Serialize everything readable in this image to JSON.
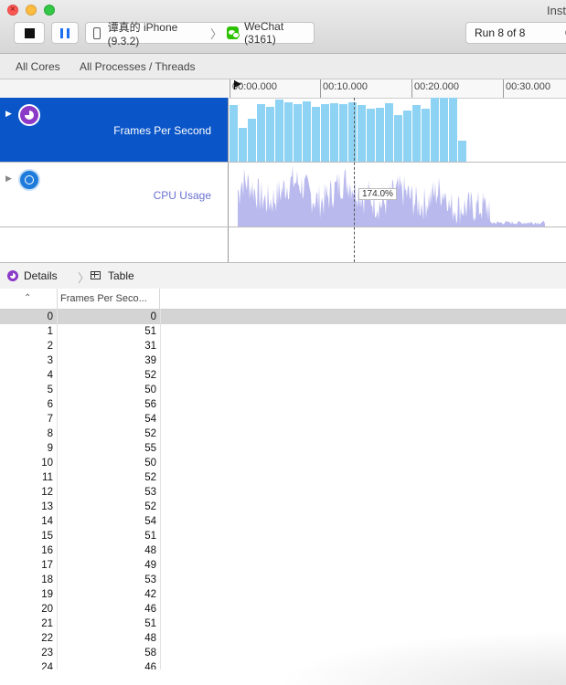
{
  "window": {
    "title": "Inst"
  },
  "toolbar": {
    "device": "谭真的 iPhone (9.3.2)",
    "process": "WeChat (3161)",
    "run": "Run 8 of 8",
    "run_extra": "0"
  },
  "scope": {
    "cores": "All Cores",
    "processes": "All Processes / Threads"
  },
  "timeline": {
    "ticks": [
      "00:00.000",
      "00:10.000",
      "00:20.000",
      "00:30.000"
    ],
    "cursor_readout": "174.0%"
  },
  "tracks": {
    "fps": {
      "name": "Frames Per Second"
    },
    "cpu": {
      "name": "CPU Usage"
    }
  },
  "fps_graph": {
    "values": [
      51,
      31,
      39,
      52,
      50,
      56,
      54,
      52,
      55,
      50,
      52,
      53,
      52,
      54,
      51,
      48,
      49,
      53,
      42,
      46,
      51,
      48,
      58,
      58,
      58,
      19
    ],
    "max": 58,
    "color": "#8fd3f4"
  },
  "detail_bar": {
    "details": "Details",
    "table": "Table"
  },
  "table": {
    "column": "Frames Per Seco...",
    "rows": [
      {
        "idx": "0",
        "val": "0"
      },
      {
        "idx": "1",
        "val": "51"
      },
      {
        "idx": "2",
        "val": "31"
      },
      {
        "idx": "3",
        "val": "39"
      },
      {
        "idx": "4",
        "val": "52"
      },
      {
        "idx": "5",
        "val": "50"
      },
      {
        "idx": "6",
        "val": "56"
      },
      {
        "idx": "7",
        "val": "54"
      },
      {
        "idx": "8",
        "val": "52"
      },
      {
        "idx": "9",
        "val": "55"
      },
      {
        "idx": "10",
        "val": "50"
      },
      {
        "idx": "11",
        "val": "52"
      },
      {
        "idx": "12",
        "val": "53"
      },
      {
        "idx": "13",
        "val": "52"
      },
      {
        "idx": "14",
        "val": "54"
      },
      {
        "idx": "15",
        "val": "51"
      },
      {
        "idx": "16",
        "val": "48"
      },
      {
        "idx": "17",
        "val": "49"
      },
      {
        "idx": "18",
        "val": "53"
      },
      {
        "idx": "19",
        "val": "42"
      },
      {
        "idx": "20",
        "val": "46"
      },
      {
        "idx": "21",
        "val": "51"
      },
      {
        "idx": "22",
        "val": "48"
      },
      {
        "idx": "23",
        "val": "58"
      },
      {
        "idx": "24",
        "val": "46"
      }
    ],
    "selected_row": 0
  }
}
